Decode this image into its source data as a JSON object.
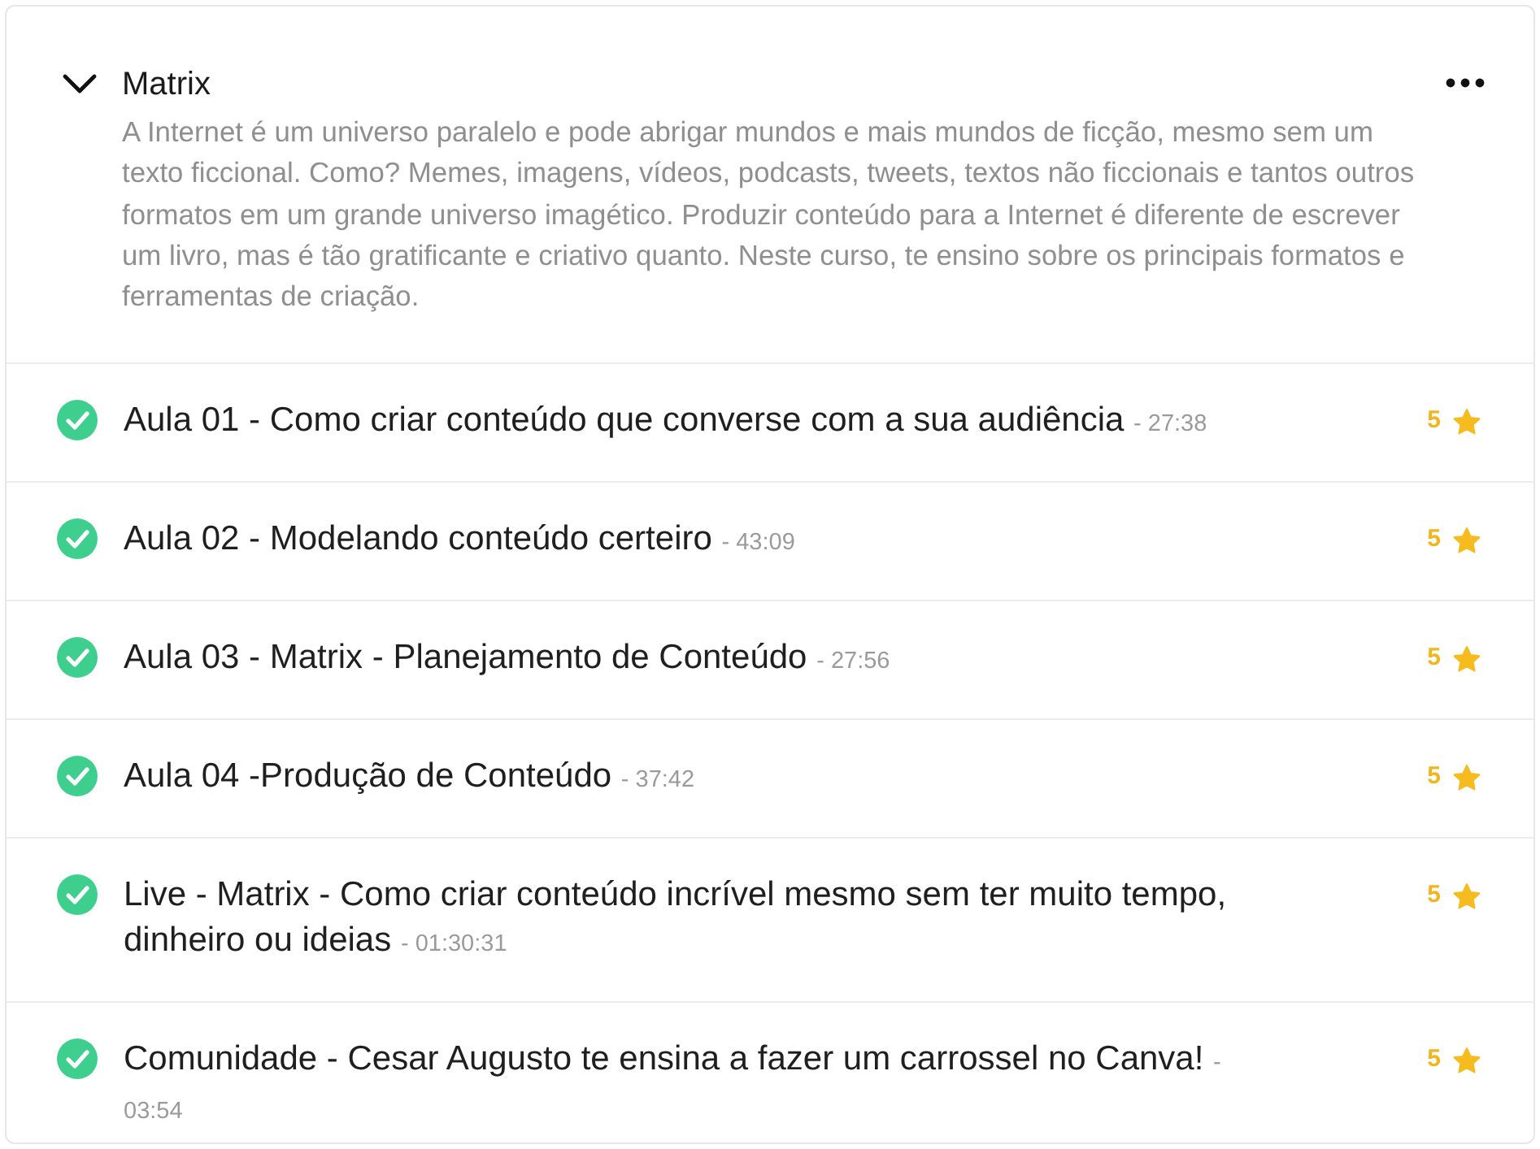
{
  "section": {
    "title": "Matrix",
    "expanded": true,
    "description": "A Internet é um universo paralelo e pode abrigar mundos e mais mundos de ficção, mesmo sem um texto ficcional. Como? Memes, imagens, vídeos, podcasts, tweets, textos não ficcionais e tantos outros formatos em um grande universo imagético. Produzir conteúdo para a Internet é diferente de escrever um livro, mas é tão gratificante e criativo quanto. Neste curso, te ensino sobre os principais formatos e ferramentas de criação."
  },
  "lessons": [
    {
      "title": "Aula 01 - Como criar conteúdo que converse com a sua audiência",
      "duration": "- 27:38",
      "completed": true,
      "rating": "5"
    },
    {
      "title": "Aula 02 - Modelando conteúdo certeiro",
      "duration": "- 43:09",
      "completed": true,
      "rating": "5"
    },
    {
      "title": "Aula 03 - Matrix - Planejamento de Conteúdo",
      "duration": "- 27:56",
      "completed": true,
      "rating": "5"
    },
    {
      "title": "Aula 04 -Produção de Conteúdo",
      "duration": "- 37:42",
      "completed": true,
      "rating": "5"
    },
    {
      "title": "Live - Matrix - Como criar conteúdo incrível mesmo sem ter muito tempo, dinheiro ou ideias",
      "duration": "- 01:30:31",
      "completed": true,
      "rating": "5"
    },
    {
      "title": "Comunidade - Cesar Augusto te ensina a fazer um carrossel no Canva!",
      "duration": "- 03:54",
      "completed": true,
      "rating": "5"
    }
  ]
}
